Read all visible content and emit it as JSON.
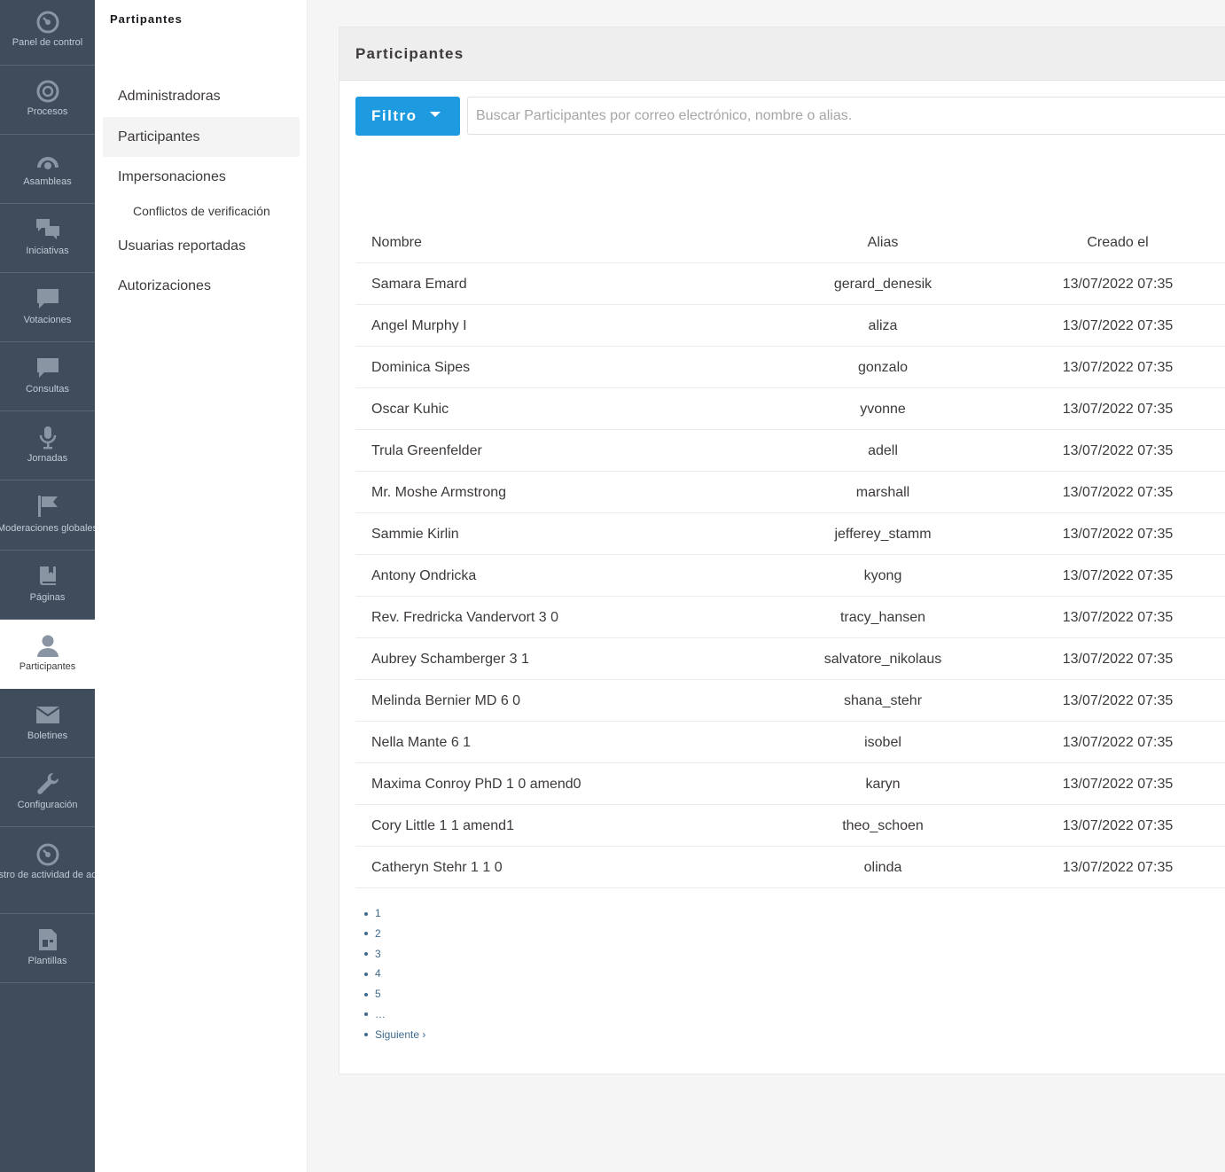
{
  "main_nav": [
    {
      "label": "Panel de control",
      "icon": "dashboard-icon"
    },
    {
      "label": "Procesos",
      "icon": "target-icon"
    },
    {
      "label": "Asambleas",
      "icon": "dome-icon"
    },
    {
      "label": "Iniciativas",
      "icon": "chat-bubbles-icon"
    },
    {
      "label": "Votaciones",
      "icon": "speech-bubble-icon"
    },
    {
      "label": "Consultas",
      "icon": "speech-bubble-icon"
    },
    {
      "label": "Jornadas",
      "icon": "microphone-icon"
    },
    {
      "label": "Moderaciones globales",
      "icon": "flag-icon"
    },
    {
      "label": "Páginas",
      "icon": "book-icon"
    },
    {
      "label": "Participantes",
      "icon": "person-icon"
    },
    {
      "label": "Boletines",
      "icon": "envelope-icon"
    },
    {
      "label": "Configuración",
      "icon": "wrench-icon"
    },
    {
      "label": "Registro de actividad de administración",
      "icon": "dashboard-icon"
    },
    {
      "label": "Plantillas",
      "icon": "template-icon"
    }
  ],
  "secondary_nav": {
    "title": "Partipantes",
    "items": [
      {
        "label": "Administradoras"
      },
      {
        "label": "Participantes"
      },
      {
        "label": "Impersonaciones"
      },
      {
        "label": "Conflictos de verificación"
      },
      {
        "label": "Usuarias reportadas"
      },
      {
        "label": "Autorizaciones"
      }
    ]
  },
  "card": {
    "title": "Participantes",
    "filter_label": "Filtro",
    "search_placeholder": "Buscar Participantes por correo electrónico, nombre o alias."
  },
  "table": {
    "headers": {
      "name": "Nombre",
      "alias": "Alias",
      "created": "Creado el"
    },
    "rows": [
      {
        "name": "Samara Emard",
        "alias": "gerard_denesik",
        "created": "13/07/2022 07:35"
      },
      {
        "name": "Angel Murphy I",
        "alias": "aliza",
        "created": "13/07/2022 07:35"
      },
      {
        "name": "Dominica Sipes",
        "alias": "gonzalo",
        "created": "13/07/2022 07:35"
      },
      {
        "name": "Oscar Kuhic",
        "alias": "yvonne",
        "created": "13/07/2022 07:35"
      },
      {
        "name": "Trula Greenfelder",
        "alias": "adell",
        "created": "13/07/2022 07:35"
      },
      {
        "name": "Mr. Moshe Armstrong",
        "alias": "marshall",
        "created": "13/07/2022 07:35"
      },
      {
        "name": "Sammie Kirlin",
        "alias": "jefferey_stamm",
        "created": "13/07/2022 07:35"
      },
      {
        "name": "Antony Ondricka",
        "alias": "kyong",
        "created": "13/07/2022 07:35"
      },
      {
        "name": "Rev. Fredricka Vandervort 3 0",
        "alias": "tracy_hansen",
        "created": "13/07/2022 07:35"
      },
      {
        "name": "Aubrey Schamberger 3 1",
        "alias": "salvatore_nikolaus",
        "created": "13/07/2022 07:35"
      },
      {
        "name": "Melinda Bernier MD 6 0",
        "alias": "shana_stehr",
        "created": "13/07/2022 07:35"
      },
      {
        "name": "Nella Mante 6 1",
        "alias": "isobel",
        "created": "13/07/2022 07:35"
      },
      {
        "name": "Maxima Conroy PhD 1 0 amend0",
        "alias": "karyn",
        "created": "13/07/2022 07:35"
      },
      {
        "name": "Cory Little 1 1 amend1",
        "alias": "theo_schoen",
        "created": "13/07/2022 07:35"
      },
      {
        "name": "Catheryn Stehr 1 1 0",
        "alias": "olinda",
        "created": "13/07/2022 07:35"
      }
    ]
  },
  "pagination": [
    "1",
    "2",
    "3",
    "4",
    "5",
    "…",
    "Siguiente ›"
  ],
  "colors": {
    "nav_bg": "#3e4c5c",
    "nav_text": "#c2cbd6",
    "primary": "#1e9ae0",
    "link": "#3e6a8f"
  }
}
